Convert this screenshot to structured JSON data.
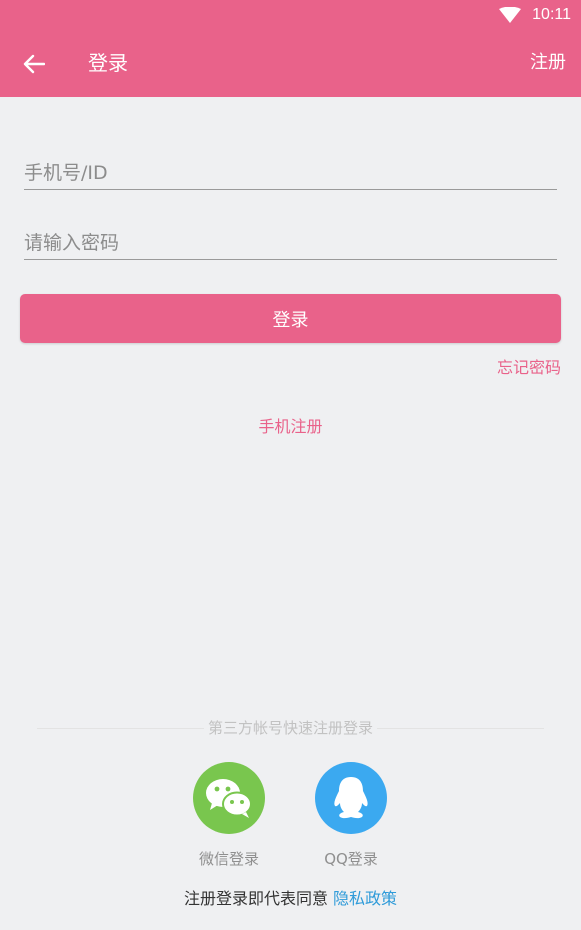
{
  "status_bar": {
    "time": "10:11"
  },
  "toolbar": {
    "title": "登录",
    "register_label": "注册"
  },
  "form": {
    "phone_placeholder": "手机号/ID",
    "phone_value": "",
    "password_placeholder": "请输入密码",
    "password_value": "",
    "login_label": "登录",
    "forgot_label": "忘记密码",
    "phone_register_label": "手机注册"
  },
  "third_party": {
    "divider_text": "第三方帐号快速注册登录",
    "wechat_label": "微信登录",
    "qq_label": "QQ登录"
  },
  "policy": {
    "text": "注册登录即代表同意",
    "link": "隐私政策"
  },
  "colors": {
    "brand": "#e9628a",
    "background": "#eff0f2",
    "wechat": "#79c64e",
    "qq": "#3ba9f0",
    "link": "#2f9bd9"
  },
  "icons": {
    "back": "arrow-left-icon",
    "wifi": "wifi-icon",
    "wechat": "wechat-icon",
    "qq": "qq-icon"
  }
}
